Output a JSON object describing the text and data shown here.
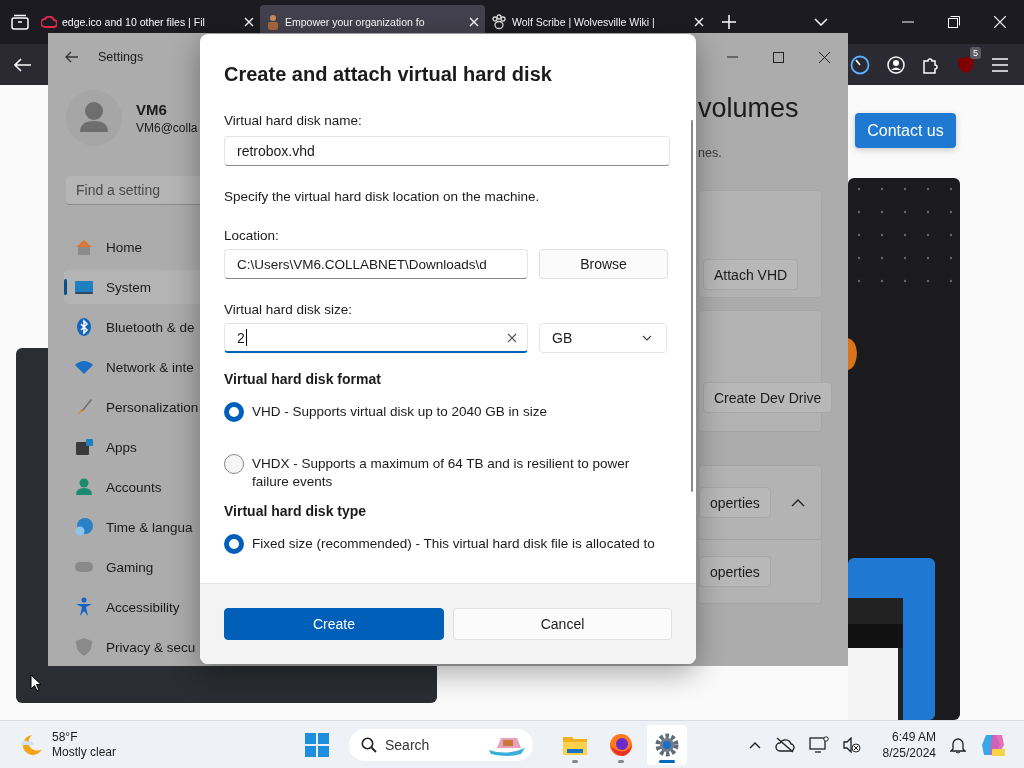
{
  "browser": {
    "tabs": [
      {
        "title": "edge.ico and 10 other files | Fil",
        "selected": false
      },
      {
        "title": "Empower your organization fo",
        "selected": true
      },
      {
        "title": "Wolf Scribe | Wolvesville Wiki |",
        "selected": false
      }
    ],
    "extension_badge": "5"
  },
  "webpage": {
    "contact_button": "Contact us"
  },
  "settings": {
    "title": "Settings",
    "user_name": "VM6",
    "user_email": "VM6@colla",
    "search_placeholder": "Find a setting",
    "nav": [
      {
        "label": "Home",
        "selected": false
      },
      {
        "label": "System",
        "selected": true
      },
      {
        "label": "Bluetooth & de",
        "selected": false
      },
      {
        "label": "Network & inte",
        "selected": false
      },
      {
        "label": "Personalization",
        "selected": false
      },
      {
        "label": "Apps",
        "selected": false
      },
      {
        "label": "Accounts",
        "selected": false
      },
      {
        "label": "Time & langua",
        "selected": false
      },
      {
        "label": "Gaming",
        "selected": false
      },
      {
        "label": "Accessibility",
        "selected": false
      },
      {
        "label": "Privacy & secu",
        "selected": false
      }
    ],
    "heading": "volumes",
    "description": "nes.",
    "actions": [
      "Attach VHD",
      "Create Dev Drive"
    ],
    "volume_group": {
      "expanded": true,
      "button": "operties",
      "child_button": "operties"
    }
  },
  "dialog": {
    "title": "Create and attach virtual hard disk",
    "name_label": "Virtual hard disk name:",
    "name_value": "retrobox.vhd",
    "location_hint": "Specify the virtual hard disk location on the machine.",
    "location_label": "Location:",
    "location_value": "C:\\Users\\VM6.COLLABNET\\Downloads\\d",
    "browse_button": "Browse",
    "size_label": "Virtual hard disk size:",
    "size_value": "2",
    "size_unit": "GB",
    "format_heading": "Virtual hard disk format",
    "format_options": [
      {
        "label": "VHD - Supports virtual disk up to 2040 GB in size",
        "selected": true
      },
      {
        "label": "VHDX - Supports a maximum of 64 TB and is resilient to power failure events",
        "selected": false
      }
    ],
    "type_heading": "Virtual hard disk type",
    "type_options": [
      {
        "label": "Fixed size (recommended) - This virtual hard disk file is allocated to",
        "selected": true
      }
    ],
    "create_button": "Create",
    "cancel_button": "Cancel"
  },
  "taskbar": {
    "temperature": "58°F",
    "weather": "Mostly clear",
    "search_placeholder": "Search",
    "apps": [
      {
        "kind": "files",
        "selected": false
      },
      {
        "kind": "firefox",
        "selected": false
      },
      {
        "kind": "settings",
        "selected": true
      }
    ],
    "time": "6:49 AM",
    "date": "8/25/2024"
  }
}
